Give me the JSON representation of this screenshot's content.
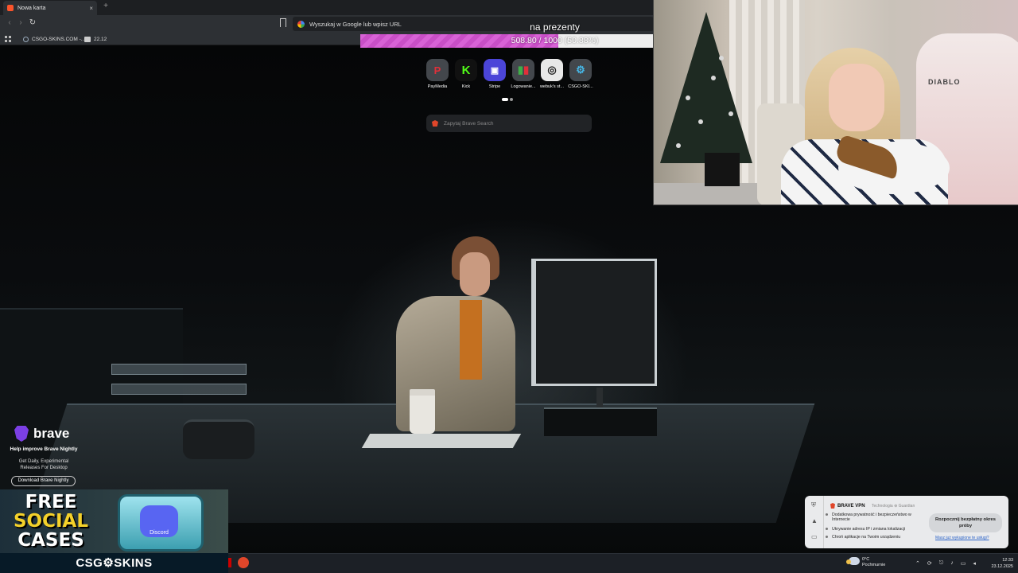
{
  "browser": {
    "tab_title": "Nowa karta",
    "tab_close": "×",
    "new_tab": "+",
    "back": "‹",
    "forward": "›",
    "reload": "↻",
    "url_placeholder": "Wyszukaj w Google lub wpisz URL",
    "bookmarks": [
      {
        "label": "CSGO-SKINS.COM -..."
      },
      {
        "label": "22.12"
      }
    ]
  },
  "goal": {
    "title": "na prezenty",
    "progress_text": "508.80 / 1000 (50.88%)",
    "current": 508.8,
    "target": 1000,
    "fraction": 0.5088,
    "fill_color": "#d862d6"
  },
  "shortcuts": [
    {
      "label": "PayMedia",
      "icon": "paymedia-icon",
      "glyph": "P",
      "color": "#e0303a"
    },
    {
      "label": "Kick",
      "icon": "kick-icon",
      "glyph": "K",
      "color": "#53fc18"
    },
    {
      "label": "Stripe",
      "icon": "stripe-icon",
      "glyph": "▣",
      "color": "#635bff"
    },
    {
      "label": "Logowanie...",
      "icon": "logowanie-icon",
      "glyph": "▮",
      "color": "#3fae49"
    },
    {
      "label": "webuk's st...",
      "icon": "webuk-icon",
      "glyph": "◎",
      "color": "#e8e8e8"
    },
    {
      "label": "CSGO-SKI...",
      "icon": "csgo-skins-icon",
      "glyph": "⚙",
      "color": "#46b8e8"
    }
  ],
  "search": {
    "placeholder": "Zapytaj Brave Search"
  },
  "brave_promo": {
    "logo_text": "brave",
    "headline": "Help improve Brave Nightly",
    "subtext": "Get Daily, Experimental Releases For Desktop",
    "button": "Download Brave Nightly"
  },
  "ad": {
    "line1": "FREE",
    "line2": "SOCIAL",
    "line3": "CASES",
    "case_label": "Discord",
    "footer": "CSG⚙SKINS"
  },
  "vpn": {
    "title": "BRAVE VPN",
    "tech": "Technologia ⊕ Guardian",
    "features": [
      "Dodatkowa prywatność i bezpieczeństwo w Internecie",
      "Ukrywanie adresu IP i zmiana lokalizacji",
      "Chroń aplikacje na Twoim urządzeniu"
    ],
    "cta": "Rozpocznij bezpłatny okres próby",
    "link": "Masz już wykupione te usługi?"
  },
  "taskbar": {
    "weather_temp": "0°C",
    "weather_desc": "Pochmurnie",
    "time": "12:33",
    "date": "23.12.2025"
  },
  "webcam": {
    "chair_brand": "DIABLO"
  }
}
